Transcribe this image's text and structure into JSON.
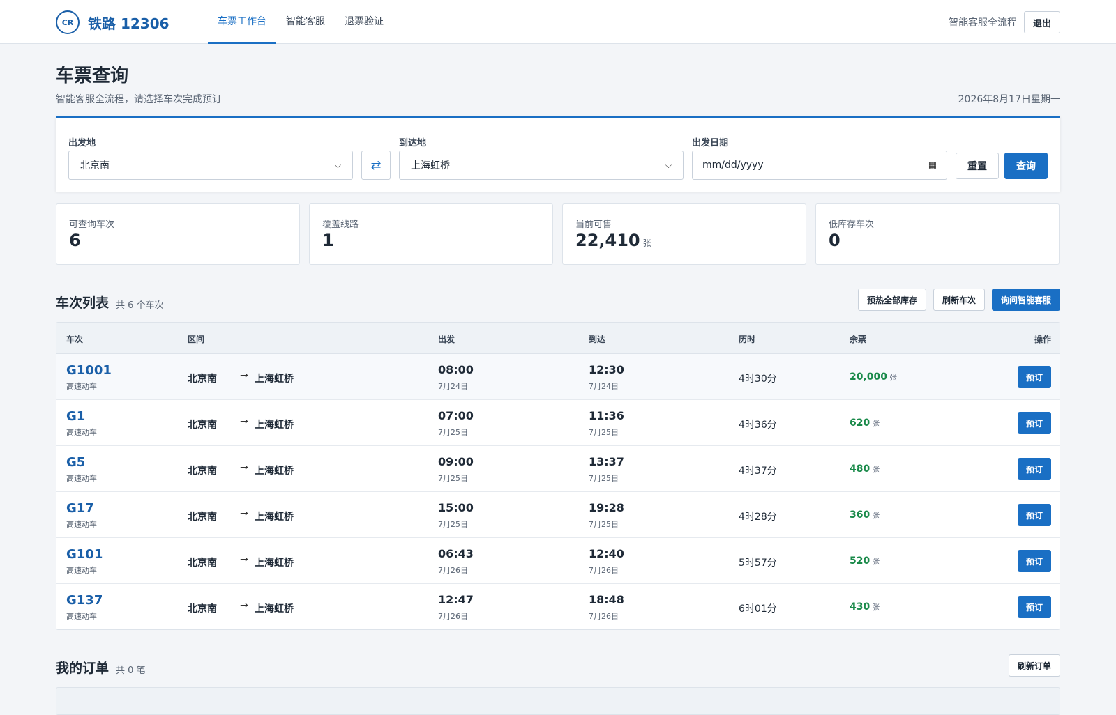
{
  "header": {
    "logo_mark": "CR",
    "logo_text": "铁路 12306",
    "nav": [
      {
        "label": "车票工作台",
        "active": true
      },
      {
        "label": "智能客服",
        "active": false
      },
      {
        "label": "退票验证",
        "active": false
      }
    ],
    "right_hint": "智能客服全流程",
    "logout_label": "退出"
  },
  "page": {
    "title": "车票查询",
    "subtitle": "智能客服全流程，请选择车次完成预订",
    "date": "2026年8月17日星期一"
  },
  "search": {
    "from_label": "出发地",
    "from_value": "北京南",
    "swap_icon": "⇄",
    "to_label": "到达地",
    "to_value": "上海虹桥",
    "date_label": "出发日期",
    "date_placeholder": "mm/dd/yyyy",
    "reset_label": "重置",
    "query_label": "查询"
  },
  "stats": [
    {
      "label": "可查询车次",
      "value": "6",
      "unit": ""
    },
    {
      "label": "覆盖线路",
      "value": "1",
      "unit": ""
    },
    {
      "label": "当前可售",
      "value": "22,410",
      "unit": "张"
    },
    {
      "label": "低库存车次",
      "value": "0",
      "unit": ""
    }
  ],
  "trains_section": {
    "title": "车次列表",
    "count": "共 6 个车次",
    "actions": {
      "preheat": "预热全部库存",
      "refresh": "刷新车次",
      "ask": "询问智能客服"
    },
    "columns": [
      "车次",
      "区间",
      "出发",
      "到达",
      "历时",
      "余票",
      "操作"
    ],
    "rows": [
      {
        "no": "G1001",
        "type": "高速动车",
        "from": "北京南",
        "to": "上海虹桥",
        "dep": "08:00",
        "dep_date": "7月24日",
        "arr": "12:30",
        "arr_date": "7月24日",
        "dur": "4时30分",
        "left": "20,000",
        "unit": "张",
        "book": "预订"
      },
      {
        "no": "G1",
        "type": "高速动车",
        "from": "北京南",
        "to": "上海虹桥",
        "dep": "07:00",
        "dep_date": "7月25日",
        "arr": "11:36",
        "arr_date": "7月25日",
        "dur": "4时36分",
        "left": "620",
        "unit": "张",
        "book": "预订"
      },
      {
        "no": "G5",
        "type": "高速动车",
        "from": "北京南",
        "to": "上海虹桥",
        "dep": "09:00",
        "dep_date": "7月25日",
        "arr": "13:37",
        "arr_date": "7月25日",
        "dur": "4时37分",
        "left": "480",
        "unit": "张",
        "book": "预订"
      },
      {
        "no": "G17",
        "type": "高速动车",
        "from": "北京南",
        "to": "上海虹桥",
        "dep": "15:00",
        "dep_date": "7月25日",
        "arr": "19:28",
        "arr_date": "7月25日",
        "dur": "4时28分",
        "left": "360",
        "unit": "张",
        "book": "预订"
      },
      {
        "no": "G101",
        "type": "高速动车",
        "from": "北京南",
        "to": "上海虹桥",
        "dep": "06:43",
        "dep_date": "7月26日",
        "arr": "12:40",
        "arr_date": "7月26日",
        "dur": "5时57分",
        "left": "520",
        "unit": "张",
        "book": "预订"
      },
      {
        "no": "G137",
        "type": "高速动车",
        "from": "北京南",
        "to": "上海虹桥",
        "dep": "12:47",
        "dep_date": "7月26日",
        "arr": "18:48",
        "arr_date": "7月26日",
        "dur": "6时01分",
        "left": "430",
        "unit": "张",
        "book": "预订"
      }
    ]
  },
  "orders_section": {
    "title": "我的订单",
    "count": "共 0 笔",
    "refresh_label": "刷新订单"
  }
}
